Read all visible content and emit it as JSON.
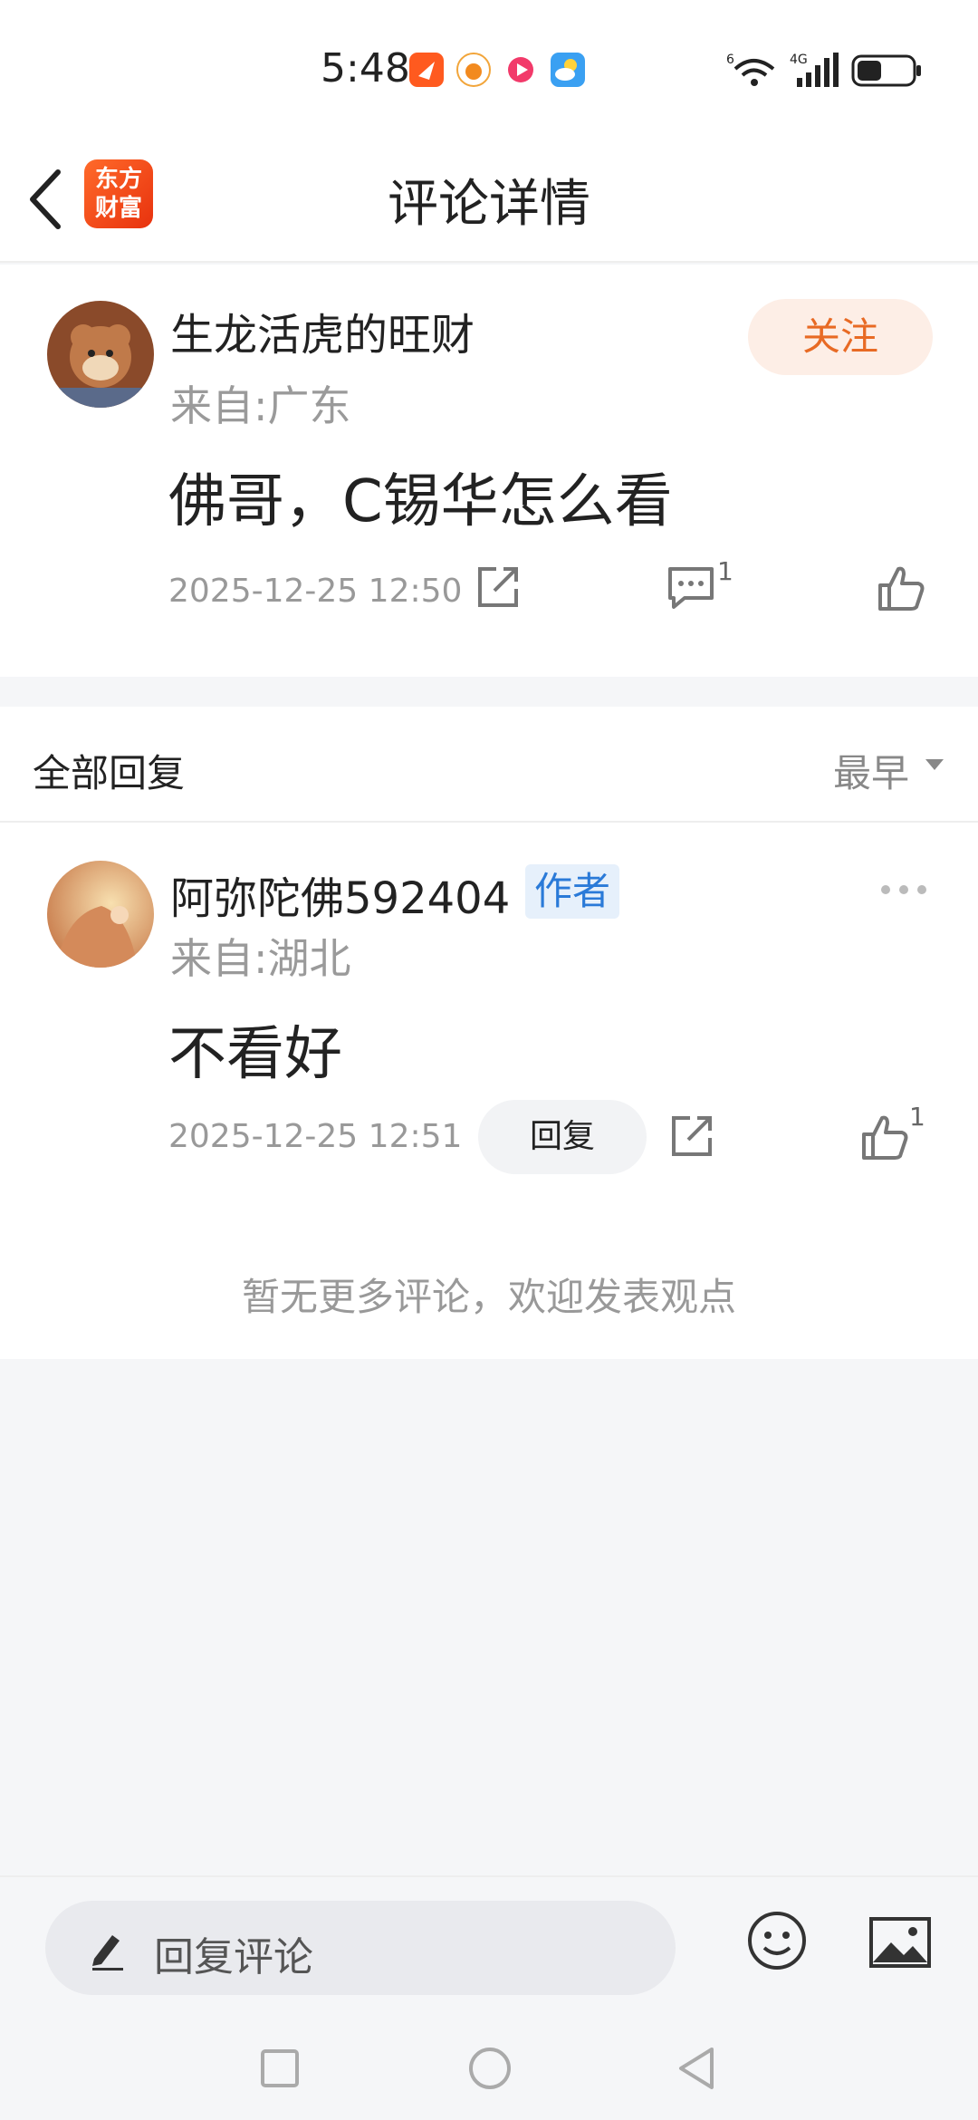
{
  "status_bar": {
    "time": "5:48",
    "app_icons": [
      "messaging-app-icon",
      "weibo-app-icon",
      "video-app-icon",
      "weather-app-icon"
    ],
    "network": "4G",
    "wifi_tag": "6"
  },
  "header": {
    "logo_line1": "东方",
    "logo_line2": "财富",
    "title": "评论详情"
  },
  "main_comment": {
    "user_name": "生龙活虎的旺财",
    "location": "来自:广东",
    "text": "佛哥，C锡华怎么看",
    "timestamp": "2025-12-25 12:50",
    "reply_count": "1",
    "follow_label": "关注"
  },
  "replies_section": {
    "title": "全部回复",
    "sort_label": "最早"
  },
  "replies": [
    {
      "user_name": "阿弥陀佛592404",
      "badge": "作者",
      "location": "来自:湖北",
      "text": "不看好",
      "timestamp": "2025-12-25 12:51",
      "reply_label": "回复",
      "like_count": "1"
    }
  ],
  "no_more_text": "暂无更多评论，欢迎发表观点",
  "bottom_bar": {
    "input_placeholder": "回复评论"
  },
  "colors": {
    "accent_orange": "#e86a24",
    "follow_bg": "#fdeee6",
    "author_badge_text": "#2a7ad8",
    "author_badge_bg": "#e6f0fb",
    "brand_red": "#e8320e"
  }
}
